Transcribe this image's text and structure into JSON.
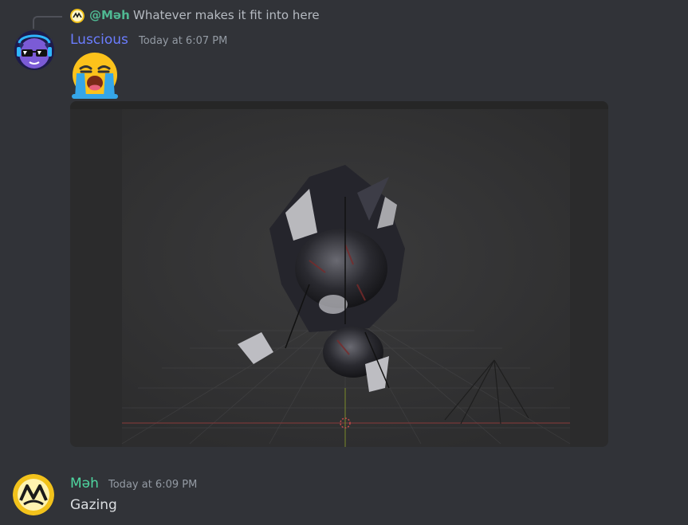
{
  "reply": {
    "author": "@Məh",
    "text": "Whatever makes it fit into here"
  },
  "messages": [
    {
      "username": "Luscious",
      "username_color": "#6b7dff",
      "timestamp": "Today at 6:07 PM",
      "emoji": "loudly-crying-face",
      "attachment": "image"
    },
    {
      "username": "Məh",
      "username_color": "#4fd6a0",
      "timestamp": "Today at 6:09 PM",
      "text": "Gazing"
    }
  ],
  "colors": {
    "background": "#313338",
    "text": "#dbdee1",
    "muted": "#949ba4",
    "reply_author": "#4fb892"
  },
  "icons": [
    "reply-spine",
    "luscious-avatar",
    "meh-avatar",
    "loudly-crying-emoji"
  ]
}
